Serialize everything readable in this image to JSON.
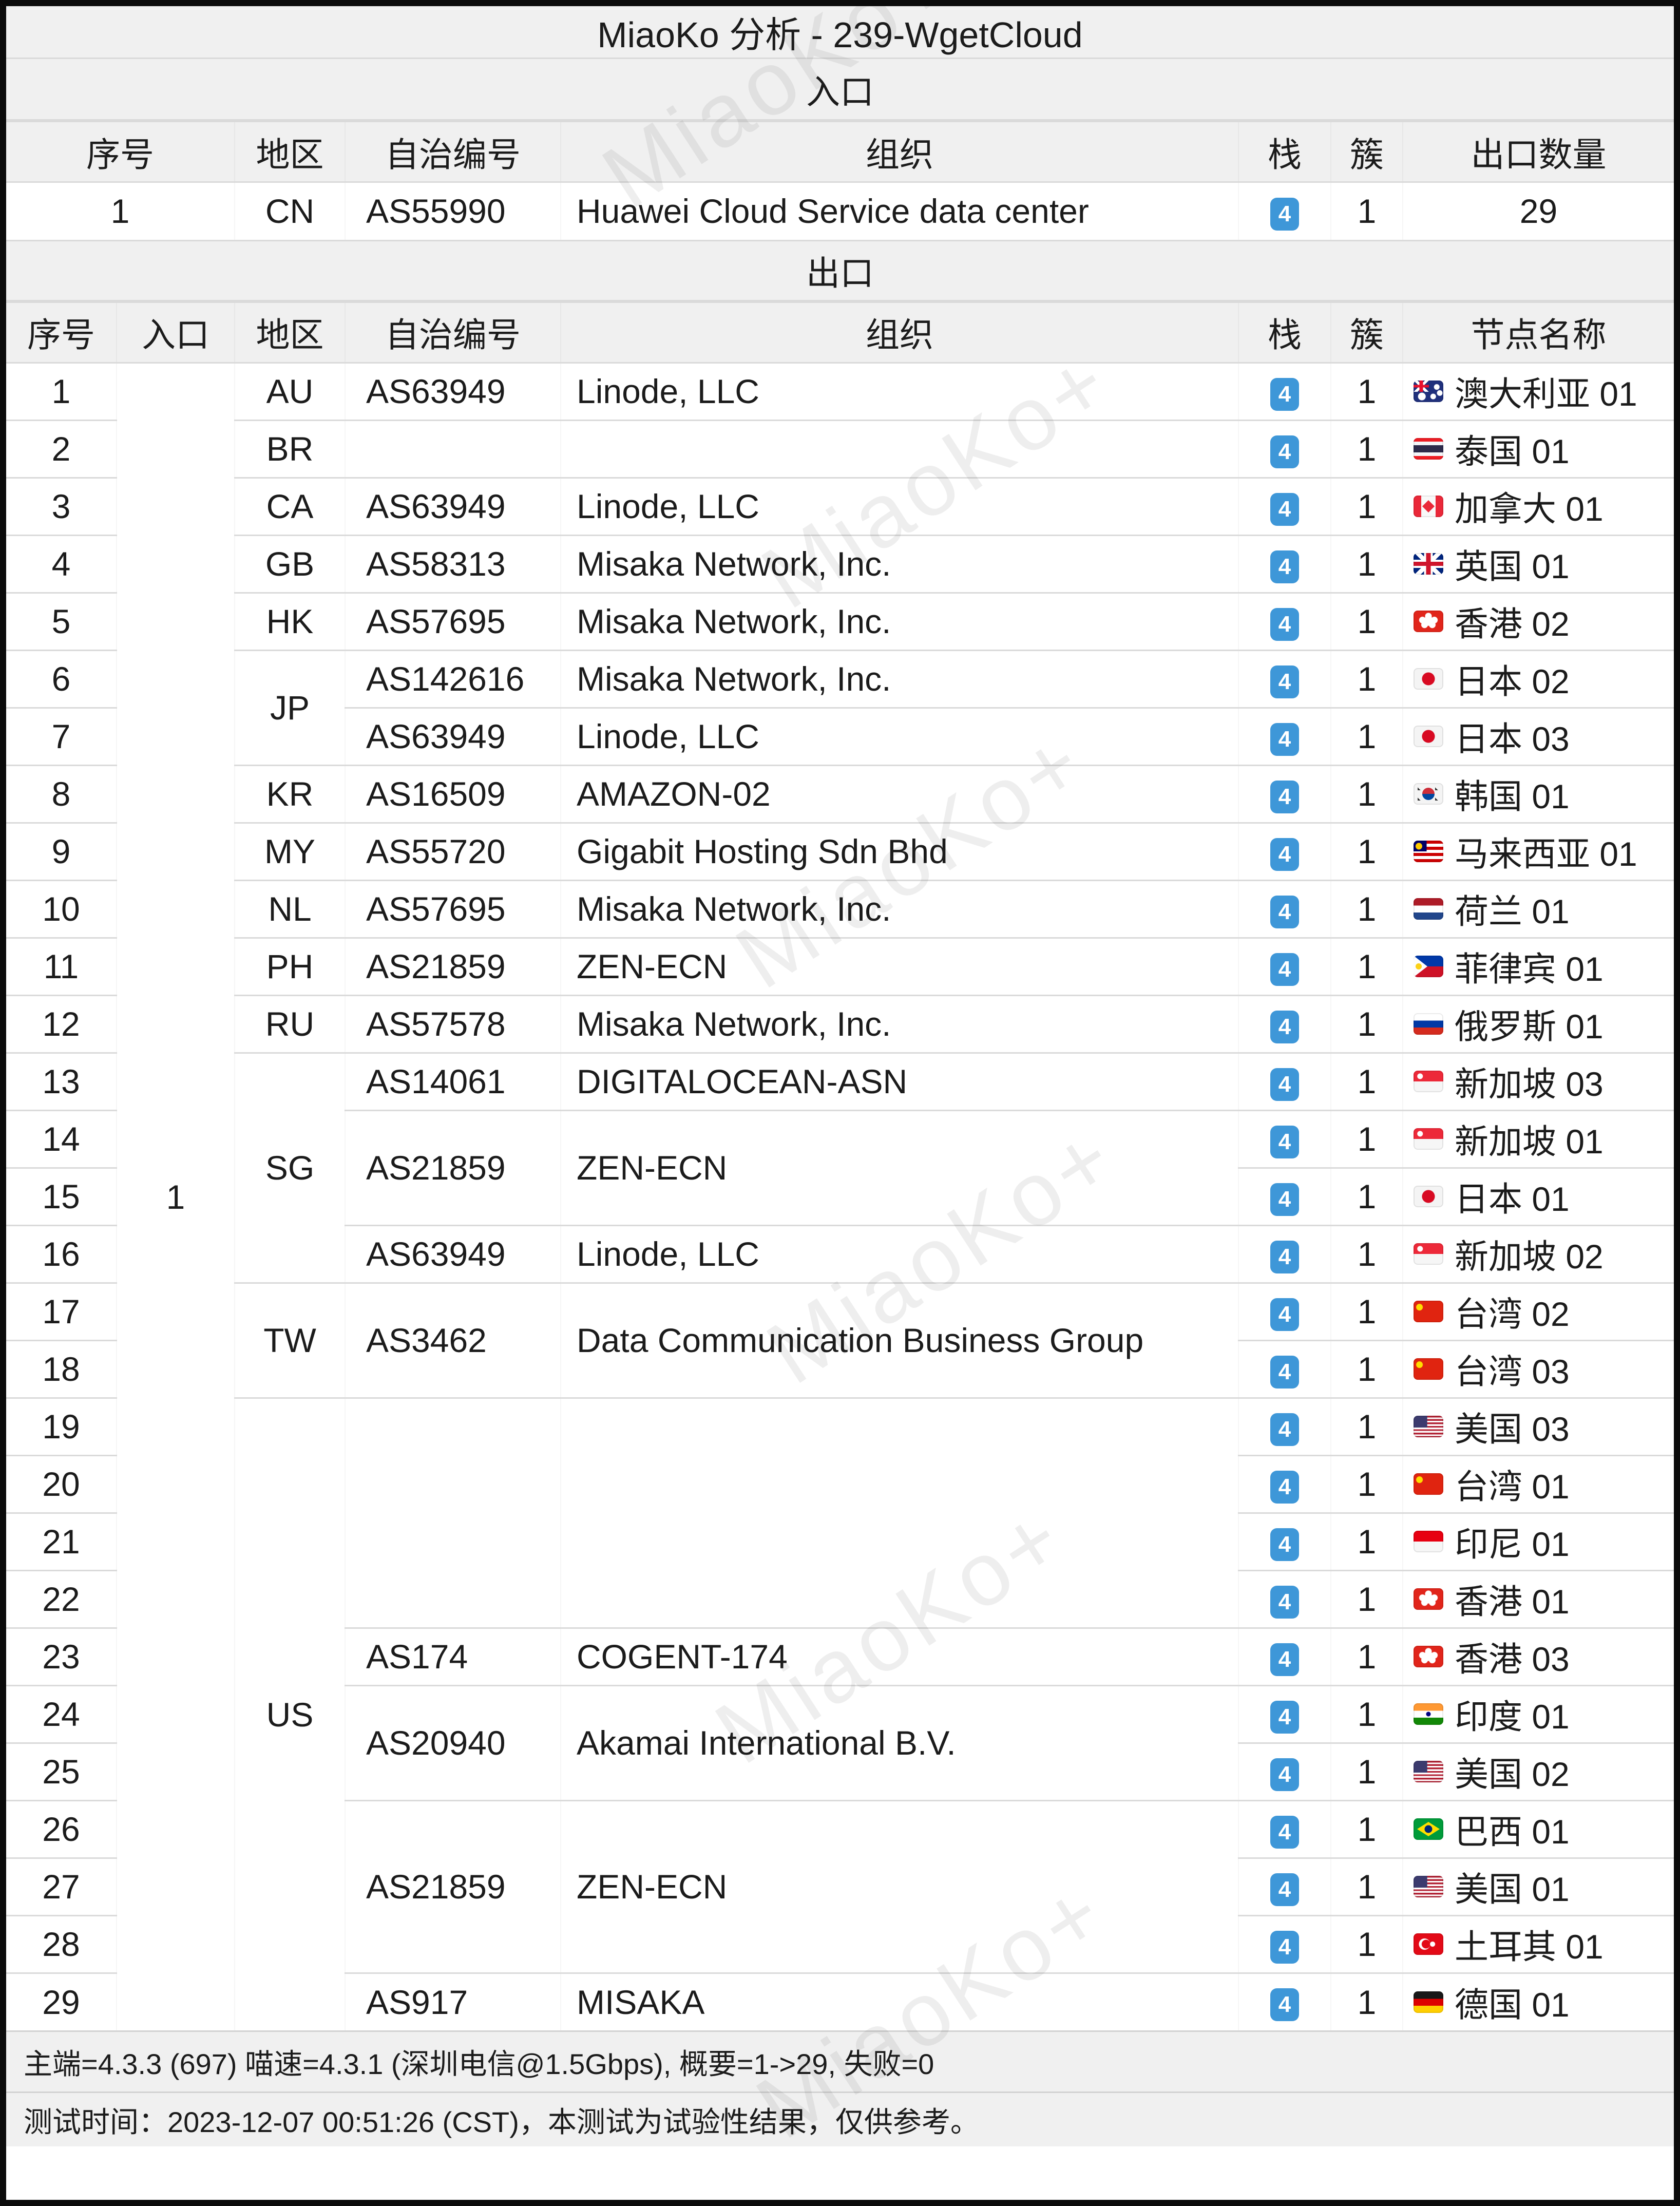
{
  "title": "MiaoKo 分析 - 239-WgetCloud",
  "watermark": "MiaoKo+",
  "colors": {
    "badge_blue": "#3e97d8",
    "header_bg": "#f0f0f0",
    "grid_line": "#dadada"
  },
  "entrance": {
    "section_label": "入口",
    "headers": [
      "序号",
      "地区",
      "自治编号",
      "组织",
      "栈",
      "簇",
      "出口数量"
    ],
    "row": {
      "index": "1",
      "region": "CN",
      "asn": "AS55990",
      "org": "Huawei Cloud Service data center",
      "stack": "4",
      "cluster": "1",
      "exit_count": "29"
    }
  },
  "exit": {
    "section_label": "出口",
    "headers": [
      "序号",
      "入口",
      "地区",
      "自治编号",
      "组织",
      "栈",
      "簇",
      "节点名称"
    ],
    "entrance_cell": {
      "v": "1",
      "s": 29
    },
    "rows": [
      {
        "i": "1",
        "rg": {
          "v": "AU",
          "s": 1
        },
        "as": {
          "a": "AS63949",
          "o": "Linode, LLC",
          "s": 1
        },
        "st": "4",
        "cl": "1",
        "nd": {
          "f": "au",
          "n": "澳大利亚 01"
        }
      },
      {
        "i": "2",
        "rg": {
          "v": "BR",
          "s": 1
        },
        "as": {
          "a": "",
          "o": "",
          "s": 1
        },
        "st": "4",
        "cl": "1",
        "nd": {
          "f": "th",
          "n": "泰国 01"
        }
      },
      {
        "i": "3",
        "rg": {
          "v": "CA",
          "s": 1
        },
        "as": {
          "a": "AS63949",
          "o": "Linode, LLC",
          "s": 1
        },
        "st": "4",
        "cl": "1",
        "nd": {
          "f": "ca",
          "n": "加拿大 01"
        }
      },
      {
        "i": "4",
        "rg": {
          "v": "GB",
          "s": 1
        },
        "as": {
          "a": "AS58313",
          "o": "Misaka Network, Inc.",
          "s": 1
        },
        "st": "4",
        "cl": "1",
        "nd": {
          "f": "gb",
          "n": "英国 01"
        }
      },
      {
        "i": "5",
        "rg": {
          "v": "HK",
          "s": 1
        },
        "as": {
          "a": "AS57695",
          "o": "Misaka Network, Inc.",
          "s": 1
        },
        "st": "4",
        "cl": "1",
        "nd": {
          "f": "hk",
          "n": "香港 02"
        }
      },
      {
        "i": "6",
        "rg": {
          "v": "JP",
          "s": 2
        },
        "as": {
          "a": "AS142616",
          "o": "Misaka Network, Inc.",
          "s": 1
        },
        "st": "4",
        "cl": "1",
        "nd": {
          "f": "jp",
          "n": "日本 02"
        }
      },
      {
        "i": "7",
        "as": {
          "a": "AS63949",
          "o": "Linode, LLC",
          "s": 1
        },
        "st": "4",
        "cl": "1",
        "nd": {
          "f": "jp",
          "n": "日本 03"
        }
      },
      {
        "i": "8",
        "rg": {
          "v": "KR",
          "s": 1
        },
        "as": {
          "a": "AS16509",
          "o": "AMAZON-02",
          "s": 1
        },
        "st": "4",
        "cl": "1",
        "nd": {
          "f": "kr",
          "n": "韩国 01"
        }
      },
      {
        "i": "9",
        "rg": {
          "v": "MY",
          "s": 1
        },
        "as": {
          "a": "AS55720",
          "o": "Gigabit Hosting Sdn Bhd",
          "s": 1
        },
        "st": "4",
        "cl": "1",
        "nd": {
          "f": "my",
          "n": "马来西亚 01"
        }
      },
      {
        "i": "10",
        "rg": {
          "v": "NL",
          "s": 1
        },
        "as": {
          "a": "AS57695",
          "o": "Misaka Network, Inc.",
          "s": 1
        },
        "st": "4",
        "cl": "1",
        "nd": {
          "f": "nl",
          "n": "荷兰 01"
        }
      },
      {
        "i": "11",
        "rg": {
          "v": "PH",
          "s": 1
        },
        "as": {
          "a": "AS21859",
          "o": "ZEN-ECN",
          "s": 1
        },
        "st": "4",
        "cl": "1",
        "nd": {
          "f": "ph",
          "n": "菲律宾 01"
        }
      },
      {
        "i": "12",
        "rg": {
          "v": "RU",
          "s": 1
        },
        "as": {
          "a": "AS57578",
          "o": "Misaka Network, Inc.",
          "s": 1
        },
        "st": "4",
        "cl": "1",
        "nd": {
          "f": "ru",
          "n": "俄罗斯 01"
        }
      },
      {
        "i": "13",
        "rg": {
          "v": "SG",
          "s": 4
        },
        "as": {
          "a": "AS14061",
          "o": "DIGITALOCEAN-ASN",
          "s": 1
        },
        "st": "4",
        "cl": "1",
        "nd": {
          "f": "sg",
          "n": "新加坡 03"
        }
      },
      {
        "i": "14",
        "as": {
          "a": "AS21859",
          "o": "ZEN-ECN",
          "s": 2
        },
        "st": "4",
        "cl": "1",
        "nd": {
          "f": "sg",
          "n": "新加坡 01"
        }
      },
      {
        "i": "15",
        "st": "4",
        "cl": "1",
        "nd": {
          "f": "jp",
          "n": "日本 01"
        }
      },
      {
        "i": "16",
        "as": {
          "a": "AS63949",
          "o": "Linode, LLC",
          "s": 1
        },
        "st": "4",
        "cl": "1",
        "nd": {
          "f": "sg",
          "n": "新加坡 02"
        }
      },
      {
        "i": "17",
        "rg": {
          "v": "TW",
          "s": 2
        },
        "as": {
          "a": "AS3462",
          "o": "Data Communication Business Group",
          "s": 2
        },
        "st": "4",
        "cl": "1",
        "nd": {
          "f": "cn",
          "n": "台湾 02"
        }
      },
      {
        "i": "18",
        "st": "4",
        "cl": "1",
        "nd": {
          "f": "cn",
          "n": "台湾 03"
        }
      },
      {
        "i": "19",
        "rg": {
          "v": "US",
          "s": 11
        },
        "as": {
          "a": "",
          "o": "",
          "s": 4
        },
        "st": "4",
        "cl": "1",
        "nd": {
          "f": "us",
          "n": "美国 03"
        }
      },
      {
        "i": "20",
        "st": "4",
        "cl": "1",
        "nd": {
          "f": "cn",
          "n": "台湾 01"
        }
      },
      {
        "i": "21",
        "st": "4",
        "cl": "1",
        "nd": {
          "f": "id",
          "n": "印尼 01"
        }
      },
      {
        "i": "22",
        "st": "4",
        "cl": "1",
        "nd": {
          "f": "hk",
          "n": "香港 01"
        }
      },
      {
        "i": "23",
        "as": {
          "a": "AS174",
          "o": "COGENT-174",
          "s": 1
        },
        "st": "4",
        "cl": "1",
        "nd": {
          "f": "hk",
          "n": "香港 03"
        }
      },
      {
        "i": "24",
        "as": {
          "a": "AS20940",
          "o": "Akamai International B.V.",
          "s": 2
        },
        "st": "4",
        "cl": "1",
        "nd": {
          "f": "in",
          "n": "印度 01"
        }
      },
      {
        "i": "25",
        "st": "4",
        "cl": "1",
        "nd": {
          "f": "us",
          "n": "美国 02"
        }
      },
      {
        "i": "26",
        "as": {
          "a": "AS21859",
          "o": "ZEN-ECN",
          "s": 3
        },
        "st": "4",
        "cl": "1",
        "nd": {
          "f": "br",
          "n": "巴西 01"
        }
      },
      {
        "i": "27",
        "st": "4",
        "cl": "1",
        "nd": {
          "f": "us",
          "n": "美国 01"
        }
      },
      {
        "i": "28",
        "st": "4",
        "cl": "1",
        "nd": {
          "f": "tr",
          "n": "土耳其 01"
        }
      },
      {
        "i": "29",
        "as": {
          "a": "AS917",
          "o": "MISAKA",
          "s": 1
        },
        "st": "4",
        "cl": "1",
        "nd": {
          "f": "de",
          "n": "德国 01"
        }
      }
    ]
  },
  "footer": {
    "line1": "主端=4.3.3 (697) 喵速=4.3.1 (深圳电信@1.5Gbps), 概要=1->29, 失败=0",
    "line2": "测试时间：2023-12-07 00:51:26 (CST)，本测试为试验性结果，仅供参考。"
  }
}
